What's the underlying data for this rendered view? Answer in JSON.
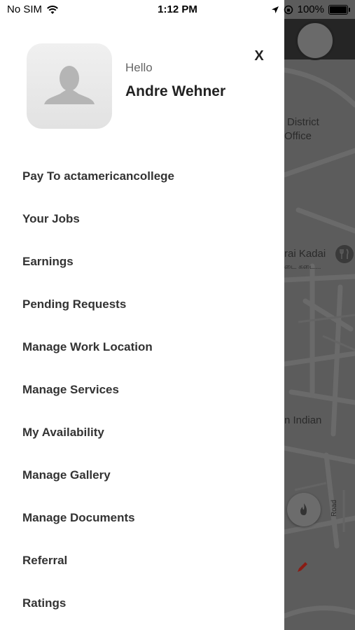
{
  "status_bar": {
    "carrier": "No SIM",
    "time": "1:12 PM",
    "battery": "100%",
    "battery_level": 1.0
  },
  "map": {
    "labels": {
      "district": "District",
      "office": "Office",
      "restaurant": "rai Kadai",
      "restaurant_sub": "டை கடை...",
      "indian": "n Indian",
      "road": "Road"
    }
  },
  "drawer": {
    "greeting": "Hello",
    "user_name": "Andre Wehner",
    "close_label": "X",
    "menu_items": [
      "Pay To actamericancollege",
      "Your Jobs",
      "Earnings",
      "Pending Requests",
      "Manage Work Location",
      "Manage Services",
      "My Availability",
      "Manage Gallery",
      "Manage Documents",
      "Referral",
      "Ratings"
    ]
  },
  "icons": [
    "wifi-icon",
    "location-arrow-icon",
    "orientation-lock-icon",
    "battery-icon",
    "avatar-placeholder-icon",
    "close-icon",
    "fork-knife-pin-icon",
    "fire-icon",
    "pencil-icon"
  ],
  "colors": {
    "drawer_bg": "#ffffff",
    "map_overlay": "#5c5c5c",
    "accent_red": "#c0392b",
    "text_primary": "#333333"
  }
}
